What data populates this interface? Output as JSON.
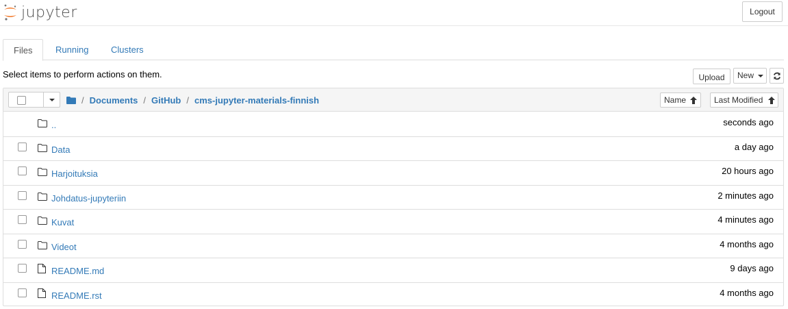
{
  "header": {
    "logo_text": "jupyter",
    "logout_label": "Logout"
  },
  "tabs": [
    {
      "label": "Files",
      "active": true
    },
    {
      "label": "Running",
      "active": false
    },
    {
      "label": "Clusters",
      "active": false
    }
  ],
  "toolbar": {
    "hint": "Select items to perform actions on them.",
    "upload_label": "Upload",
    "new_label": "New",
    "refresh_icon": "refresh-icon"
  },
  "breadcrumb": {
    "items": [
      "Documents",
      "GitHub",
      "cms-jupyter-materials-finnish"
    ],
    "separator": "/"
  },
  "sort": {
    "name_label": "Name",
    "modified_label": "Last Modified"
  },
  "files": [
    {
      "name": "..",
      "type": "folder",
      "modified": "seconds ago"
    },
    {
      "name": "Data",
      "type": "folder",
      "modified": "a day ago"
    },
    {
      "name": "Harjoituksia",
      "type": "folder",
      "modified": "20 hours ago"
    },
    {
      "name": "Johdatus-jupyteriin",
      "type": "folder",
      "modified": "2 minutes ago"
    },
    {
      "name": "Kuvat",
      "type": "folder",
      "modified": "4 minutes ago"
    },
    {
      "name": "Videot",
      "type": "folder",
      "modified": "4 months ago"
    },
    {
      "name": "README.md",
      "type": "file",
      "modified": "9 days ago"
    },
    {
      "name": "README.rst",
      "type": "file",
      "modified": "4 months ago"
    }
  ],
  "colors": {
    "link": "#337ab7",
    "logo_orange": "#f37726",
    "border": "#dddddd"
  }
}
